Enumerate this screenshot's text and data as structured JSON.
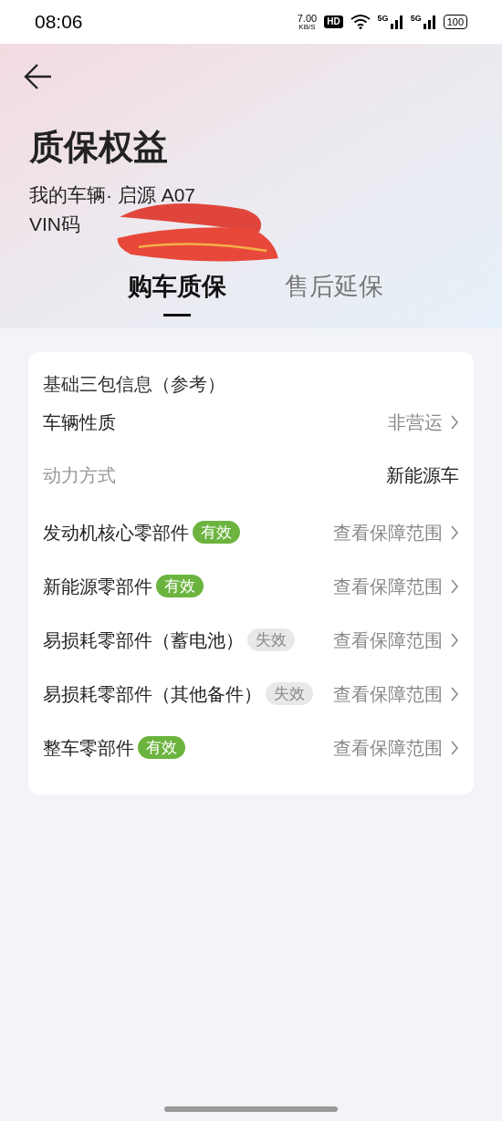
{
  "status_bar": {
    "time": "08:06",
    "speed_value": "7.00",
    "speed_unit": "KB/S",
    "hd": "HD",
    "networks": [
      "5G",
      "5G"
    ],
    "battery": "100"
  },
  "header": {
    "title": "质保权益",
    "vehicle": "我的车辆· 启源 A07",
    "vin": "VIN码"
  },
  "tabs": [
    {
      "label": "购车质保",
      "selected": true
    },
    {
      "label": "售后延保",
      "selected": false
    }
  ],
  "card": {
    "rows": [
      {
        "kind": "heading",
        "label": "基础三包信息（参考）"
      },
      {
        "kind": "link",
        "label": "车辆性质",
        "value": "非营运"
      },
      {
        "kind": "info",
        "label": "动力方式",
        "value": "新能源车"
      },
      {
        "kind": "part",
        "label": "发动机核心零部件",
        "badge": "有效",
        "valid": true,
        "link": "查看保障范围"
      },
      {
        "kind": "part",
        "label": "新能源零部件",
        "badge": "有效",
        "valid": true,
        "link": "查看保障范围"
      },
      {
        "kind": "part",
        "label": "易损耗零部件（蓄电池）",
        "badge": "失效",
        "valid": false,
        "link": "查看保障范围"
      },
      {
        "kind": "part",
        "label": "易损耗零部件（其他备件）",
        "badge": "失效",
        "valid": false,
        "link": "查看保障范围"
      },
      {
        "kind": "part",
        "label": "整车零部件",
        "badge": "有效",
        "valid": true,
        "link": "查看保障范围"
      }
    ]
  }
}
